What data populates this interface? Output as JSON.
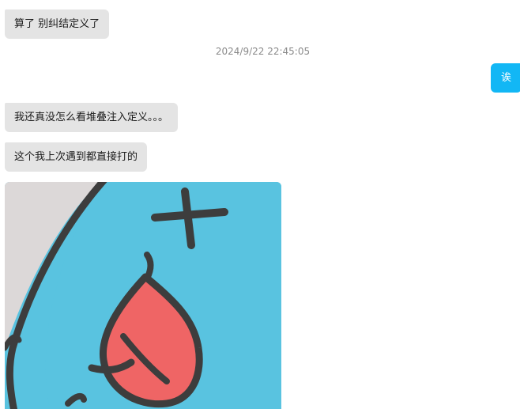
{
  "messages": [
    {
      "direction": "incoming",
      "text": "算了  别纠结定义了"
    },
    {
      "type": "timestamp",
      "text": "2024/9/22 22:45:05"
    },
    {
      "direction": "outgoing",
      "text": "诶"
    },
    {
      "direction": "incoming",
      "text": "我还真没怎么看堆叠注入定义。。。"
    },
    {
      "direction": "incoming",
      "text": "这个我上次遇到都直接打的"
    },
    {
      "direction": "incoming",
      "type": "image",
      "icon": "sticker-image"
    }
  ],
  "colors": {
    "incoming_bubble": "#e4e4e4",
    "outgoing_bubble": "#12b7f5",
    "sticker_blue": "#59c3e0",
    "sticker_tongue": "#ef6565",
    "sticker_outline": "#3d3d3d"
  }
}
